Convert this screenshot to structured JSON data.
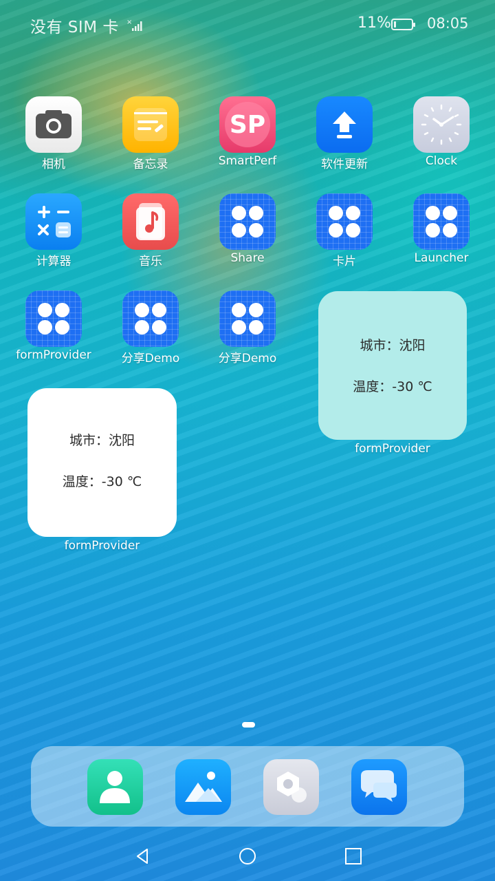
{
  "status_bar": {
    "carrier": "没有 SIM 卡",
    "signal_icon": "signal-no-service-icon",
    "battery_percent": "11%",
    "battery_level": 0.11,
    "time": "08:05"
  },
  "apps": [
    {
      "label": "相机",
      "icon": "camera-icon"
    },
    {
      "label": "备忘录",
      "icon": "notes-icon"
    },
    {
      "label": "SmartPerf",
      "icon": "smartperf-icon"
    },
    {
      "label": "软件更新",
      "icon": "software-update-icon"
    },
    {
      "label": "Clock",
      "icon": "clock-icon"
    },
    {
      "label": "计算器",
      "icon": "calculator-icon"
    },
    {
      "label": "音乐",
      "icon": "music-icon"
    },
    {
      "label": "Share",
      "icon": "generic-app-icon"
    },
    {
      "label": "卡片",
      "icon": "generic-app-icon"
    },
    {
      "label": "Launcher",
      "icon": "generic-app-icon"
    },
    {
      "label": "formProvider",
      "icon": "generic-app-icon"
    },
    {
      "label": "分享Demo",
      "icon": "generic-app-icon"
    },
    {
      "label": "分享Demo",
      "icon": "generic-app-icon"
    }
  ],
  "smartperf_logo_text": "SP",
  "widgets": [
    {
      "city": "城市：沈阳",
      "temperature": "温度：-30 ℃",
      "caption": "formProvider",
      "color": "#b3ecea"
    },
    {
      "city": "城市：沈阳",
      "temperature": "温度：-30 ℃",
      "caption": "formProvider",
      "color": "#ffffff"
    }
  ],
  "dock": [
    {
      "name": "contacts",
      "icon": "contacts-icon"
    },
    {
      "name": "gallery",
      "icon": "gallery-icon"
    },
    {
      "name": "settings",
      "icon": "settings-icon"
    },
    {
      "name": "messages",
      "icon": "messages-icon"
    }
  ],
  "nav": [
    "back-icon",
    "home-icon",
    "recents-icon"
  ]
}
